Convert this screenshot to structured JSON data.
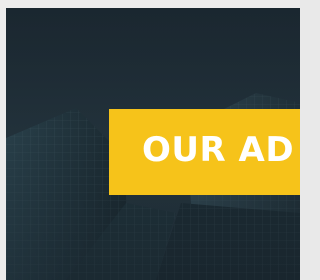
{
  "hero": {
    "banner_text": "OUR AD"
  },
  "colors": {
    "banner_bg": "#f6c31a",
    "banner_text": "#ffffff",
    "overlay": "#1d2a33"
  }
}
